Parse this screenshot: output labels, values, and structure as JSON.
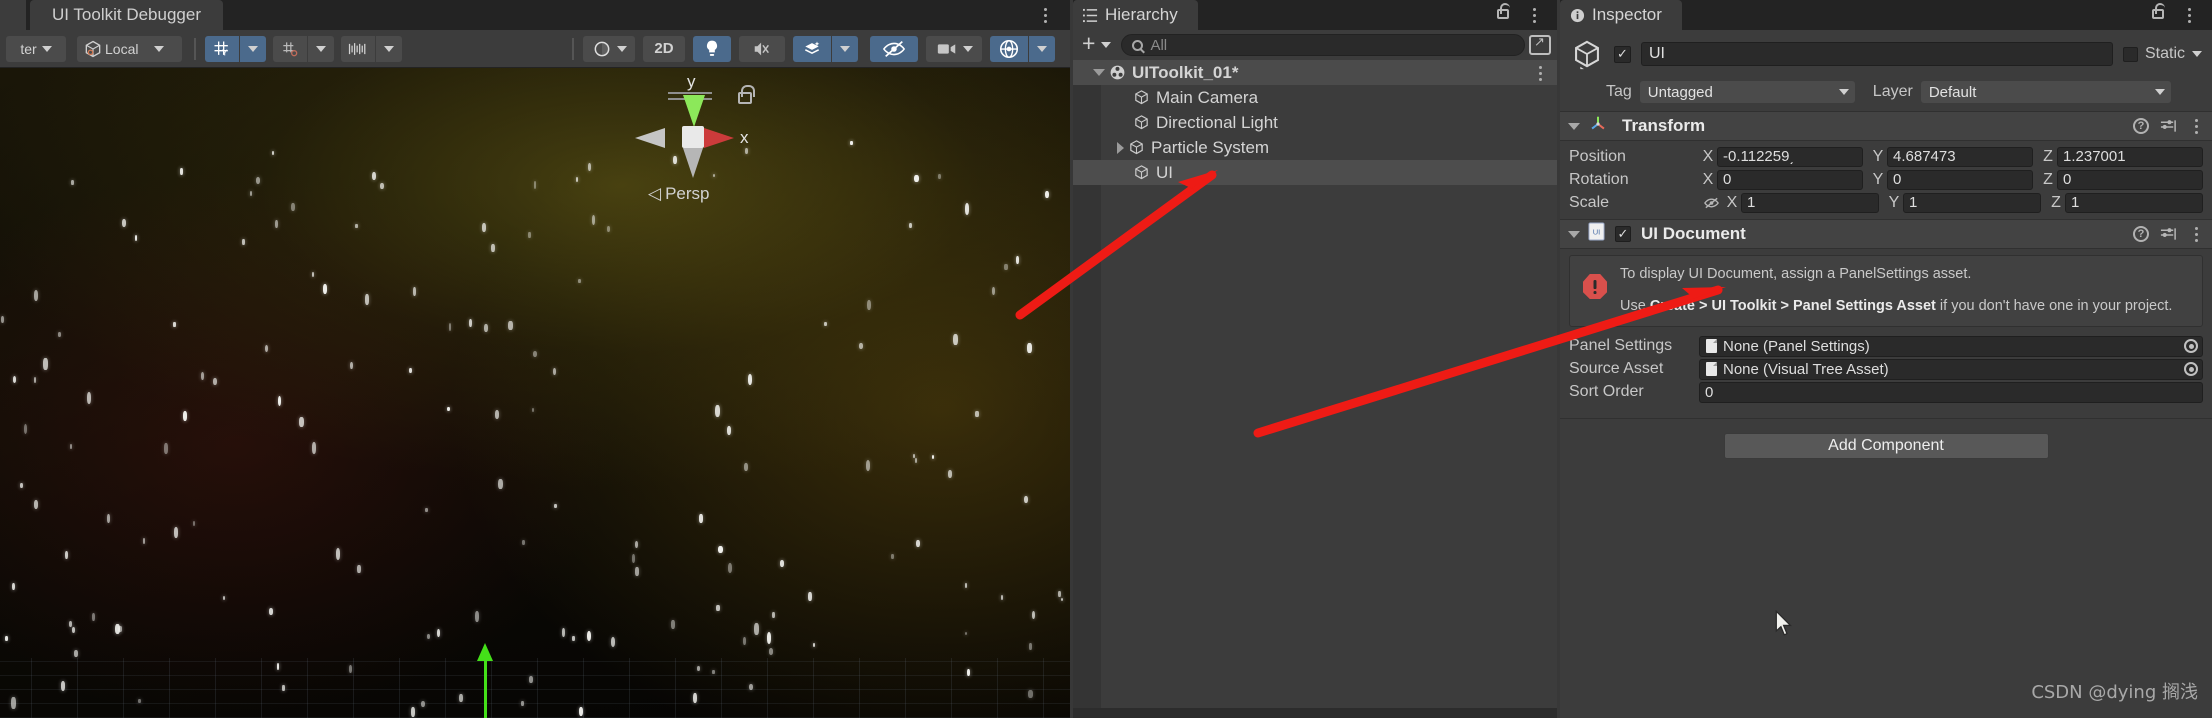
{
  "scene_window": {
    "tab_label": "UI Toolkit Debugger",
    "overflow_menu": "kebab-menu",
    "toolbar": {
      "pivot_mode_label": "ter",
      "handle_space_label": "Local",
      "grid_snap_icon": "grid-snapping-icon",
      "grid_snap_dropdown": "grid-snapping-dropdown",
      "snap_increment_icon": "snap-increment-icon",
      "snap_increment_dropdown": "snap-increment-dropdown",
      "ruler_icon": "grid-visibility-icon",
      "ruler_dropdown": "grid-visibility-dropdown",
      "draw_mode_icon": "shaded-draw-mode-icon",
      "draw_mode_dropdown": "draw-mode-dropdown",
      "two_d_label": "2D",
      "lighting_icon": "scene-lighting-icon",
      "audio_icon": "scene-audio-muted-icon",
      "fx_icon": "scene-fx-icon",
      "fx_dropdown": "scene-fx-dropdown",
      "hidden_objects_icon": "scene-visibility-icon",
      "camera_icon": "scene-camera-icon",
      "camera_dropdown": "scene-camera-dropdown",
      "gizmos_icon": "gizmos-icon",
      "gizmos_dropdown": "gizmos-dropdown"
    },
    "gizmo": {
      "y_label": "y",
      "x_label": "x",
      "projection_label": "Persp",
      "lock_icon": "lock-open-icon"
    }
  },
  "hierarchy": {
    "tab_label": "Hierarchy",
    "tab_icon": "hierarchy-icon",
    "lock_icon": "lock-open-icon",
    "overflow_menu": "kebab-menu",
    "add_button": "plus-icon",
    "add_dropdown": "chevron-down-icon",
    "search": {
      "value": "",
      "placeholder": "All",
      "icon": "search-icon"
    },
    "expand_button": "open-in-new-icon",
    "items": [
      {
        "label": "UIToolkit_01*",
        "depth": 0,
        "twisty": "down",
        "icon": "scene-icon",
        "selected": false,
        "is_scene": true
      },
      {
        "label": "Main Camera",
        "depth": 1,
        "twisty": "none",
        "icon": "gameobject-icon",
        "selected": false,
        "is_scene": false
      },
      {
        "label": "Directional Light",
        "depth": 1,
        "twisty": "none",
        "icon": "gameobject-icon",
        "selected": false,
        "is_scene": false
      },
      {
        "label": "Particle System",
        "depth": 1,
        "twisty": "right",
        "icon": "gameobject-icon",
        "selected": false,
        "is_scene": false
      },
      {
        "label": "UI",
        "depth": 1,
        "twisty": "none",
        "icon": "gameobject-icon",
        "selected": true,
        "is_scene": false
      }
    ]
  },
  "inspector": {
    "tab_label": "Inspector",
    "tab_icon": "info-icon",
    "lock_icon": "lock-open-icon",
    "overflow_menu": "kebab-menu",
    "object_icon": "gameobject-icon",
    "enabled_checkbox": "✓",
    "name": "UI",
    "static_label": "Static",
    "static_dropdown": "chevron-down-icon",
    "tag_label": "Tag",
    "tag_value": "Untagged",
    "layer_label": "Layer",
    "layer_value": "Default",
    "components": [
      {
        "title": "Transform",
        "icon": "transform-icon",
        "help_icon": "help-icon",
        "preset_icon": "preset-icon",
        "menu_icon": "kebab-menu",
        "rows": [
          {
            "label": "Position",
            "axes": [
              "X",
              "Y",
              "Z"
            ],
            "values": [
              "-0.112259͵",
              "4.687473",
              "1.237001"
            ],
            "link_icon": ""
          },
          {
            "label": "Rotation",
            "axes": [
              "X",
              "Y",
              "Z"
            ],
            "values": [
              "0",
              "0",
              "0"
            ],
            "link_icon": ""
          },
          {
            "label": "Scale",
            "axes": [
              "X",
              "Y",
              "Z"
            ],
            "values": [
              "1",
              "1",
              "1"
            ],
            "link_icon": "constrain-proportions-off-icon"
          }
        ]
      },
      {
        "title": "UI Document",
        "icon": "ui-document-icon",
        "enabled_checkbox": "✓",
        "help_icon": "help-icon",
        "preset_icon": "preset-icon",
        "menu_icon": "kebab-menu",
        "helpbox": {
          "icon": "error-icon",
          "line1": "To display UI Document, assign a PanelSettings asset.",
          "line2_prefix": "Use ",
          "line2_bold": "Create > UI Toolkit > Panel Settings Asset",
          "line2_suffix": " if you don't have one in your project."
        },
        "fields": [
          {
            "label": "Panel Settings",
            "value": "None (Panel Settings)",
            "type": "object",
            "icon": "asset-icon",
            "picker": "object-picker-icon"
          },
          {
            "label": "Source Asset",
            "value": "None (Visual Tree Asset)",
            "type": "object",
            "icon": "asset-icon",
            "picker": "object-picker-icon"
          },
          {
            "label": "Sort Order",
            "value": "0",
            "type": "number"
          }
        ]
      }
    ],
    "add_component_label": "Add Component"
  },
  "watermark": "CSDN @dying 搁浅",
  "colors": {
    "panel_bg": "#3c3c3c",
    "dark_bg": "#232323",
    "field_bg": "#2a2a2a",
    "accent_blue": "#4b6a8c",
    "annotation_red": "#ee1b15",
    "axis_green": "#44e019",
    "axis_red": "#cc3b3b"
  }
}
